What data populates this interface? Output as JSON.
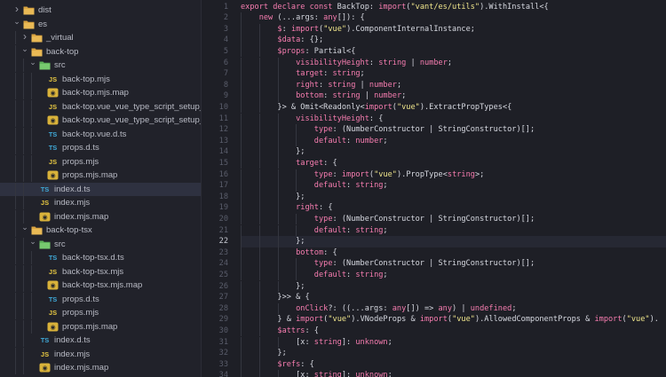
{
  "explorer": {
    "items": [
      {
        "depth": 1,
        "kind": "folder",
        "label": "dist",
        "open": false
      },
      {
        "depth": 1,
        "kind": "folder",
        "label": "es",
        "open": true
      },
      {
        "depth": 2,
        "kind": "folder",
        "label": "_virtual",
        "open": false
      },
      {
        "depth": 2,
        "kind": "folder",
        "label": "back-top",
        "open": true
      },
      {
        "depth": 3,
        "kind": "folder-src",
        "label": "src",
        "open": true
      },
      {
        "depth": 4,
        "kind": "js",
        "label": "back-top.mjs"
      },
      {
        "depth": 4,
        "kind": "map",
        "label": "back-top.mjs.map"
      },
      {
        "depth": 4,
        "kind": "js",
        "label": "back-top.vue_vue_type_script_setup_..."
      },
      {
        "depth": 4,
        "kind": "map",
        "label": "back-top.vue_vue_type_script_setup_..."
      },
      {
        "depth": 4,
        "kind": "ts",
        "label": "back-top.vue.d.ts"
      },
      {
        "depth": 4,
        "kind": "ts",
        "label": "props.d.ts"
      },
      {
        "depth": 4,
        "kind": "js",
        "label": "props.mjs"
      },
      {
        "depth": 4,
        "kind": "map",
        "label": "props.mjs.map"
      },
      {
        "depth": 3,
        "kind": "ts",
        "label": "index.d.ts",
        "selected": true
      },
      {
        "depth": 3,
        "kind": "js",
        "label": "index.mjs"
      },
      {
        "depth": 3,
        "kind": "map",
        "label": "index.mjs.map"
      },
      {
        "depth": 2,
        "kind": "folder",
        "label": "back-top-tsx",
        "open": true
      },
      {
        "depth": 3,
        "kind": "folder-src",
        "label": "src",
        "open": true
      },
      {
        "depth": 4,
        "kind": "ts",
        "label": "back-top-tsx.d.ts"
      },
      {
        "depth": 4,
        "kind": "js",
        "label": "back-top-tsx.mjs"
      },
      {
        "depth": 4,
        "kind": "map",
        "label": "back-top-tsx.mjs.map"
      },
      {
        "depth": 4,
        "kind": "ts",
        "label": "props.d.ts"
      },
      {
        "depth": 4,
        "kind": "js",
        "label": "props.mjs"
      },
      {
        "depth": 4,
        "kind": "map",
        "label": "props.mjs.map"
      },
      {
        "depth": 3,
        "kind": "ts",
        "label": "index.d.ts"
      },
      {
        "depth": 3,
        "kind": "js",
        "label": "index.mjs"
      },
      {
        "depth": 3,
        "kind": "map",
        "label": "index.mjs.map"
      }
    ],
    "badges": {
      "js": "JS",
      "ts": "TS"
    }
  },
  "editor": {
    "active_line": 22,
    "lines": [
      {
        "n": "1",
        "indent": 0,
        "tokens": [
          [
            "kw",
            "export declare const "
          ],
          [
            "plain",
            "BackTop: "
          ],
          [
            "kw",
            "import"
          ],
          [
            "plain",
            "("
          ],
          [
            "str",
            "\"vant/es/utils\""
          ],
          [
            "plain",
            ").WithInstall<{"
          ]
        ]
      },
      {
        "n": "2",
        "indent": 1,
        "tokens": [
          [
            "kw",
            "new "
          ],
          [
            "plain",
            "(...args: "
          ],
          [
            "kw",
            "any"
          ],
          [
            "plain",
            "[]): {"
          ]
        ]
      },
      {
        "n": "3",
        "indent": 2,
        "tokens": [
          [
            "prop",
            "$"
          ],
          [
            "plain",
            ": "
          ],
          [
            "kw",
            "import"
          ],
          [
            "plain",
            "("
          ],
          [
            "str",
            "\"vue\""
          ],
          [
            "plain",
            ").ComponentInternalInstance;"
          ]
        ]
      },
      {
        "n": "4",
        "indent": 2,
        "tokens": [
          [
            "prop",
            "$data"
          ],
          [
            "plain",
            ": {};"
          ]
        ]
      },
      {
        "n": "5",
        "indent": 2,
        "tokens": [
          [
            "prop",
            "$props"
          ],
          [
            "plain",
            ": Partial<{"
          ]
        ]
      },
      {
        "n": "6",
        "indent": 3,
        "tokens": [
          [
            "prop",
            "visibilityHeight"
          ],
          [
            "plain",
            ": "
          ],
          [
            "kw",
            "string"
          ],
          [
            "plain",
            " | "
          ],
          [
            "kw",
            "number"
          ],
          [
            "plain",
            ";"
          ]
        ]
      },
      {
        "n": "7",
        "indent": 3,
        "tokens": [
          [
            "prop",
            "target"
          ],
          [
            "plain",
            ": "
          ],
          [
            "kw",
            "string"
          ],
          [
            "plain",
            ";"
          ]
        ]
      },
      {
        "n": "8",
        "indent": 3,
        "tokens": [
          [
            "prop",
            "right"
          ],
          [
            "plain",
            ": "
          ],
          [
            "kw",
            "string"
          ],
          [
            "plain",
            " | "
          ],
          [
            "kw",
            "number"
          ],
          [
            "plain",
            ";"
          ]
        ]
      },
      {
        "n": "9",
        "indent": 3,
        "tokens": [
          [
            "prop",
            "bottom"
          ],
          [
            "plain",
            ": "
          ],
          [
            "kw",
            "string"
          ],
          [
            "plain",
            " | "
          ],
          [
            "kw",
            "number"
          ],
          [
            "plain",
            ";"
          ]
        ]
      },
      {
        "n": "10",
        "indent": 2,
        "tokens": [
          [
            "plain",
            "}> & Omit<Readonly<"
          ],
          [
            "kw",
            "import"
          ],
          [
            "plain",
            "("
          ],
          [
            "str",
            "\"vue\""
          ],
          [
            "plain",
            ").ExtractPropTypes<{"
          ]
        ]
      },
      {
        "n": "11",
        "indent": 3,
        "tokens": [
          [
            "prop",
            "visibilityHeight"
          ],
          [
            "plain",
            ": {"
          ]
        ]
      },
      {
        "n": "12",
        "indent": 4,
        "tokens": [
          [
            "prop",
            "type"
          ],
          [
            "plain",
            ": (NumberConstructor | StringConstructor)[];"
          ]
        ]
      },
      {
        "n": "13",
        "indent": 4,
        "tokens": [
          [
            "prop",
            "default"
          ],
          [
            "plain",
            ": "
          ],
          [
            "kw",
            "number"
          ],
          [
            "plain",
            ";"
          ]
        ]
      },
      {
        "n": "14",
        "indent": 3,
        "tokens": [
          [
            "plain",
            "};"
          ]
        ]
      },
      {
        "n": "15",
        "indent": 3,
        "tokens": [
          [
            "prop",
            "target"
          ],
          [
            "plain",
            ": {"
          ]
        ]
      },
      {
        "n": "16",
        "indent": 4,
        "tokens": [
          [
            "prop",
            "type"
          ],
          [
            "plain",
            ": "
          ],
          [
            "kw",
            "import"
          ],
          [
            "plain",
            "("
          ],
          [
            "str",
            "\"vue\""
          ],
          [
            "plain",
            ").PropType<"
          ],
          [
            "kw",
            "string"
          ],
          [
            "plain",
            ">;"
          ]
        ]
      },
      {
        "n": "17",
        "indent": 4,
        "tokens": [
          [
            "prop",
            "default"
          ],
          [
            "plain",
            ": "
          ],
          [
            "kw",
            "string"
          ],
          [
            "plain",
            ";"
          ]
        ]
      },
      {
        "n": "18",
        "indent": 3,
        "tokens": [
          [
            "plain",
            "};"
          ]
        ]
      },
      {
        "n": "19",
        "indent": 3,
        "tokens": [
          [
            "prop",
            "right"
          ],
          [
            "plain",
            ": {"
          ]
        ]
      },
      {
        "n": "20",
        "indent": 4,
        "tokens": [
          [
            "prop",
            "type"
          ],
          [
            "plain",
            ": (NumberConstructor | StringConstructor)[];"
          ]
        ]
      },
      {
        "n": "21",
        "indent": 4,
        "tokens": [
          [
            "prop",
            "default"
          ],
          [
            "plain",
            ": "
          ],
          [
            "kw",
            "string"
          ],
          [
            "plain",
            ";"
          ]
        ]
      },
      {
        "n": "22",
        "indent": 3,
        "tokens": [
          [
            "plain",
            "};"
          ]
        ]
      },
      {
        "n": "23",
        "indent": 3,
        "tokens": [
          [
            "prop",
            "bottom"
          ],
          [
            "plain",
            ": {"
          ]
        ]
      },
      {
        "n": "24",
        "indent": 4,
        "tokens": [
          [
            "prop",
            "type"
          ],
          [
            "plain",
            ": (NumberConstructor | StringConstructor)[];"
          ]
        ]
      },
      {
        "n": "25",
        "indent": 4,
        "tokens": [
          [
            "prop",
            "default"
          ],
          [
            "plain",
            ": "
          ],
          [
            "kw",
            "string"
          ],
          [
            "plain",
            ";"
          ]
        ]
      },
      {
        "n": "26",
        "indent": 3,
        "tokens": [
          [
            "plain",
            "};"
          ]
        ]
      },
      {
        "n": "27",
        "indent": 2,
        "tokens": [
          [
            "plain",
            "}>> & {"
          ]
        ]
      },
      {
        "n": "28",
        "indent": 3,
        "tokens": [
          [
            "prop",
            "onClick"
          ],
          [
            "plain",
            "?: ((...args: "
          ],
          [
            "kw",
            "any"
          ],
          [
            "plain",
            "[]) => "
          ],
          [
            "kw",
            "any"
          ],
          [
            "plain",
            ") | "
          ],
          [
            "kw",
            "undefined"
          ],
          [
            "plain",
            ";"
          ]
        ]
      },
      {
        "n": "29",
        "indent": 2,
        "tokens": [
          [
            "plain",
            "} & "
          ],
          [
            "kw",
            "import"
          ],
          [
            "plain",
            "("
          ],
          [
            "str",
            "\"vue\""
          ],
          [
            "plain",
            ").VNodeProps & "
          ],
          [
            "kw",
            "import"
          ],
          [
            "plain",
            "("
          ],
          [
            "str",
            "\"vue\""
          ],
          [
            "plain",
            ").AllowedComponentProps & "
          ],
          [
            "kw",
            "import"
          ],
          [
            "plain",
            "("
          ],
          [
            "str",
            "\"vue\""
          ],
          [
            "plain",
            ")."
          ]
        ]
      },
      {
        "n": "30",
        "indent": 2,
        "tokens": [
          [
            "prop",
            "$attrs"
          ],
          [
            "plain",
            ": {"
          ]
        ]
      },
      {
        "n": "31",
        "indent": 3,
        "tokens": [
          [
            "plain",
            "[x: "
          ],
          [
            "kw",
            "string"
          ],
          [
            "plain",
            "]: "
          ],
          [
            "kw",
            "unknown"
          ],
          [
            "plain",
            ";"
          ]
        ]
      },
      {
        "n": "32",
        "indent": 2,
        "tokens": [
          [
            "plain",
            "};"
          ]
        ]
      },
      {
        "n": "33",
        "indent": 2,
        "tokens": [
          [
            "prop",
            "$refs"
          ],
          [
            "plain",
            ": {"
          ]
        ]
      },
      {
        "n": "34",
        "indent": 3,
        "tokens": [
          [
            "plain",
            "[x: "
          ],
          [
            "kw",
            "string"
          ],
          [
            "plain",
            "]: "
          ],
          [
            "kw",
            "unknown"
          ],
          [
            "plain",
            ";"
          ]
        ]
      }
    ]
  }
}
